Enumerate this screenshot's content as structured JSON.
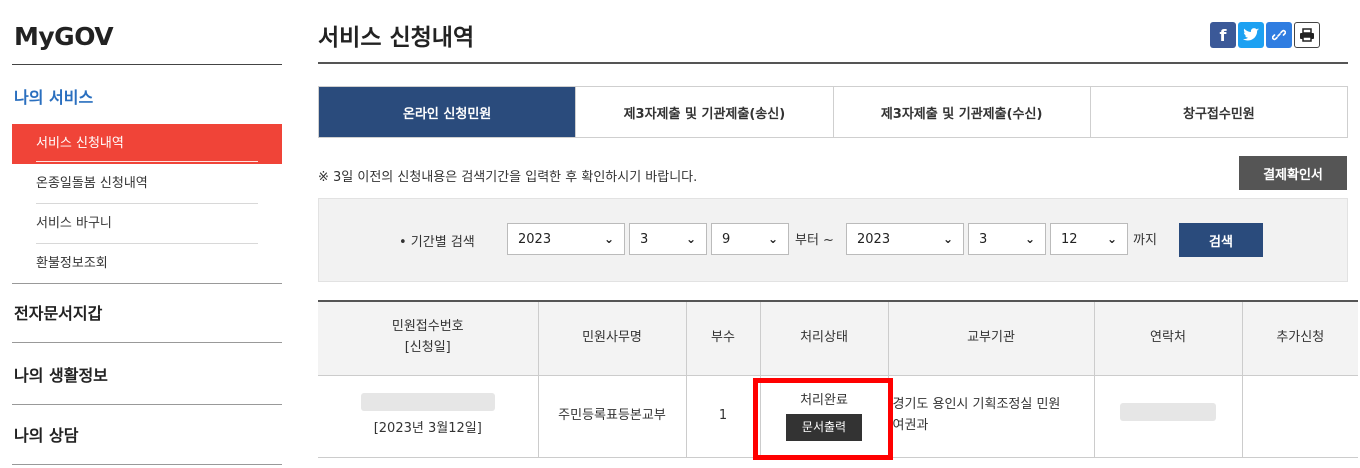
{
  "sidebar": {
    "brand": "MyGOV",
    "my_services": "나의 서비스",
    "submenu": [
      {
        "label": "서비스 신청내역",
        "active": true
      },
      {
        "label": "온종일돌봄 신청내역"
      },
      {
        "label": "서비스 바구니"
      },
      {
        "label": "환불정보조회"
      }
    ],
    "sections": [
      "전자문서지갑",
      "나의 생활정보",
      "나의 상담"
    ]
  },
  "page_title": "서비스 신청내역",
  "share": {
    "facebook": "f",
    "twitter": "t",
    "link": "🔗",
    "print": "🖶"
  },
  "tabs": [
    {
      "label": "온라인 신청민원",
      "active": true
    },
    {
      "label": "제3자제출 및 기관제출(송신)"
    },
    {
      "label": "제3자제출 및 기관제출(수신)"
    },
    {
      "label": "창구접수민원"
    }
  ],
  "notice": "※ 3일 이전의 신청내용은 검색기간을 입력한 후 확인하시기 바랍니다.",
  "receipt_button": "결제확인서",
  "search": {
    "label": "• 기간별 검색",
    "from": {
      "year": "2023",
      "month": "3",
      "day": "9"
    },
    "from_suffix": "부터 ~",
    "to": {
      "year": "2023",
      "month": "3",
      "day": "12"
    },
    "to_suffix": "까지",
    "button": "검색"
  },
  "table": {
    "headers": [
      "민원접수번호",
      "[신청일]",
      "민원사무명",
      "부수",
      "처리상태",
      "교부기관",
      "연락처",
      "추가신청"
    ],
    "row": {
      "date": "[2023년 3월12일]",
      "service": "주민등록표등본교부",
      "copies": "1",
      "status": "처리완료",
      "print_button": "문서출력",
      "agency_line1": "경기도 용인시 기획조정실 민원",
      "agency_line2": "여권과"
    }
  },
  "colors": {
    "accent_red": "#f04438",
    "navy": "#2a4b7c",
    "highlight": "#ff0000"
  }
}
